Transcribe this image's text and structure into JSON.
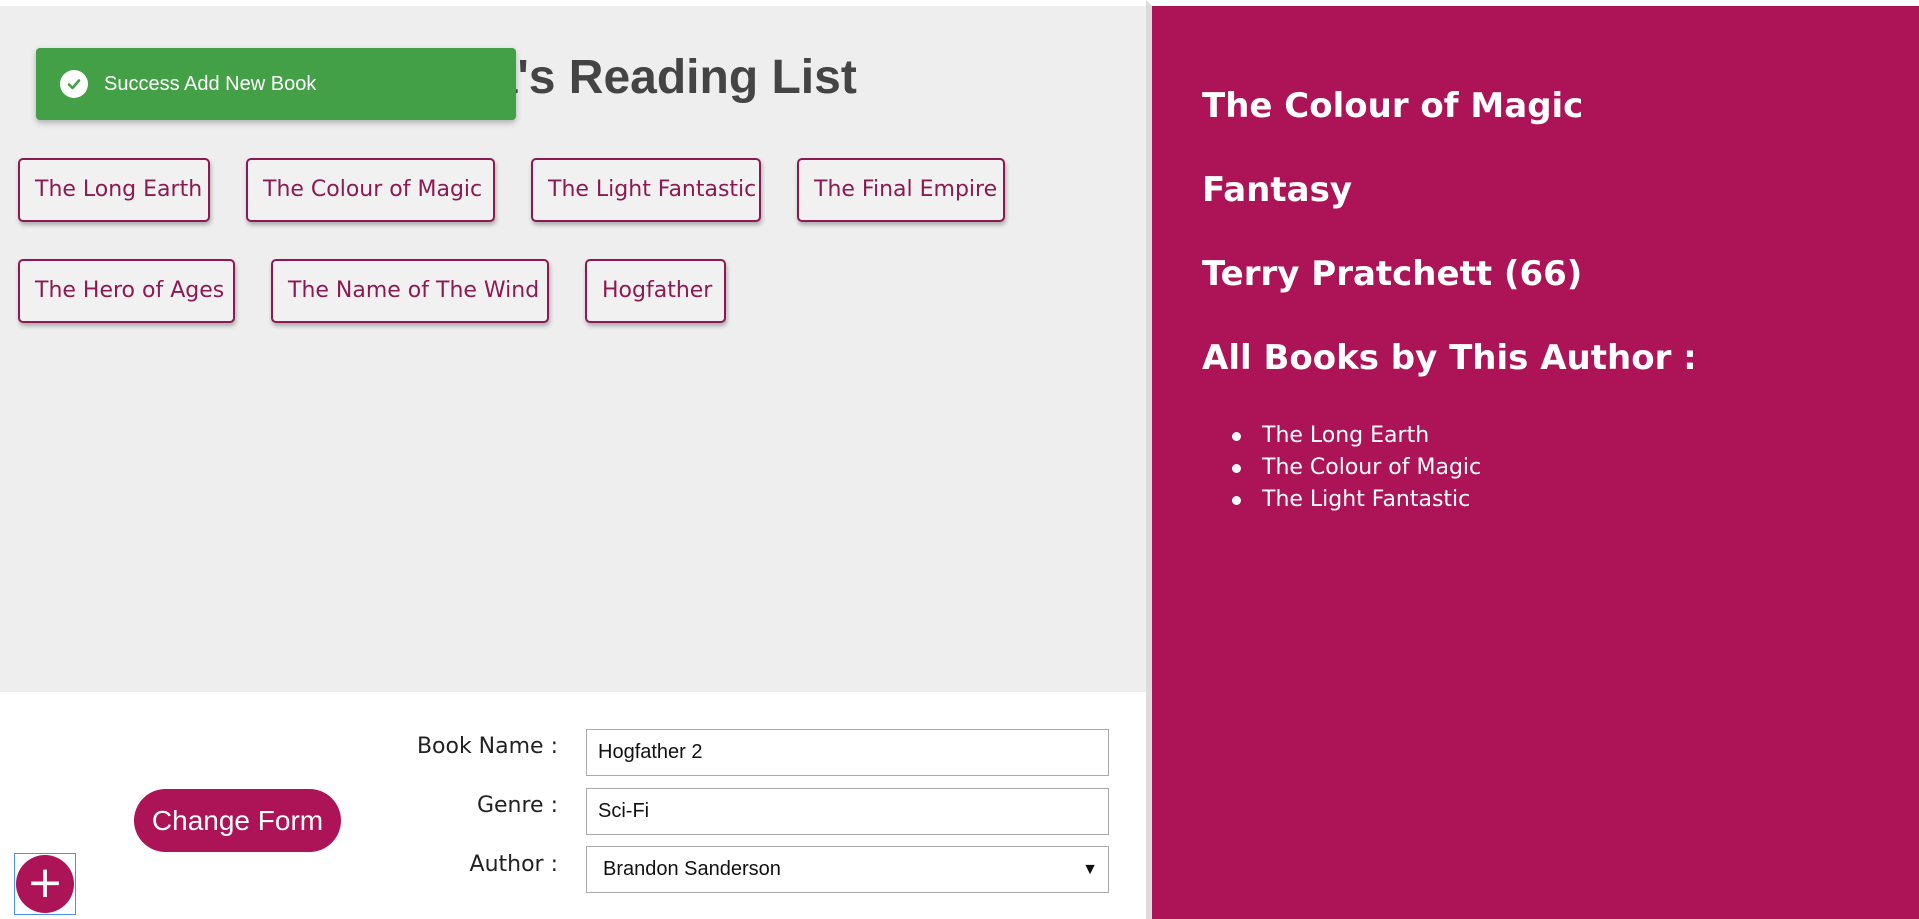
{
  "header": {
    "title": "Ninja's Reading List"
  },
  "toast": {
    "message": "Success Add New Book",
    "icon": "check-circle-icon",
    "color": "#43a047"
  },
  "books": [
    "The Long Earth",
    "The Colour of Magic",
    "The Light Fantastic",
    "The Final Empire",
    "The Hero of Ages",
    "The Name of The Wind",
    "Hogfather"
  ],
  "details": {
    "book_name": "The Colour of Magic",
    "genre": "Fantasy",
    "author": "Terry Pratchett (66)",
    "all_books_heading": "All Books by This Author :",
    "author_books": [
      "The Long Earth",
      "The Colour of Magic",
      "The Light Fantastic"
    ],
    "background": "#ad1457"
  },
  "form": {
    "book_name_label": "Book Name :",
    "book_name_value": "Hogfather 2",
    "genre_label": "Genre :",
    "genre_value": "Sci-Fi",
    "author_label": "Author :",
    "author_value": "Brandon Sanderson",
    "change_form_label": "Change Form",
    "add_label": "+"
  },
  "colors": {
    "accent": "#ad1457",
    "list_bg": "#eeeeee"
  }
}
